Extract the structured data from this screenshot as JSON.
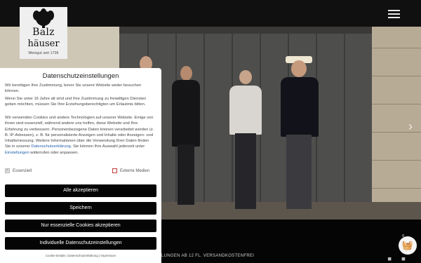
{
  "header": {
    "menu_icon": "hamburger-icon",
    "logo": {
      "line1": "Balz",
      "line2": "häuser",
      "line3": "Weingut seit 1706",
      "mark_icon": "flourish-emblem-icon"
    }
  },
  "hero": {
    "next_icon": "chevron-right-icon",
    "next_label": "›"
  },
  "ticker": {
    "text": "LUNGEN AB 12 FL. VERSANDKOSTENFREI"
  },
  "cart": {
    "count": "0",
    "icon": "shopping-basket-icon",
    "glyph": "🧺"
  },
  "footer_icons": {
    "text": "◼ ◼"
  },
  "consent": {
    "title": "Datenschutzeinstellungen",
    "para1": "Wir benötigen Ihre Zustimmung, bevor Sie unsere Website weiter besuchen können.",
    "para2": "Wenn Sie unter 16 Jahre alt sind und Ihre Zustimmung zu freiwilligen Diensten geben möchten, müssen Sie Ihre Erziehungsberechtigten um Erlaubnis bitten.",
    "para3_a": "Wir verwenden Cookies und andere Technologien auf unserer Website. Einige von ihnen sind essenziell, während andere uns helfen, diese Website und Ihre Erfahrung zu verbessern. Personenbezogene Daten können verarbeitet werden (z. B. IP-Adressen), z. B. für personalisierte Anzeigen und Inhalte oder Anzeigen- und Inhaltsmessung. Weitere Informationen über die Verwendung Ihrer Daten finden Sie in unserer ",
    "para3_link1": "Datenschutzerklärung",
    "para3_b": ". Sie können Ihre Auswahl jederzeit unter ",
    "para3_link2": "Einstellungen",
    "para3_c": " widerrufen oder anpassen.",
    "checkbox_essential": "Essenziell",
    "checkbox_external": "Externe Medien",
    "btn_accept_all": "Alle akzeptieren",
    "btn_save": "Speichern",
    "btn_essential_only": "Nur essenzielle Cookies akzeptieren",
    "btn_individual": "Individuelle Datenschutzeinstellungen",
    "link_cookie_details": "Cookie-Details",
    "link_privacy": "Datenschutzerklärung",
    "link_imprint": "Impressum",
    "link_sep": "|"
  }
}
